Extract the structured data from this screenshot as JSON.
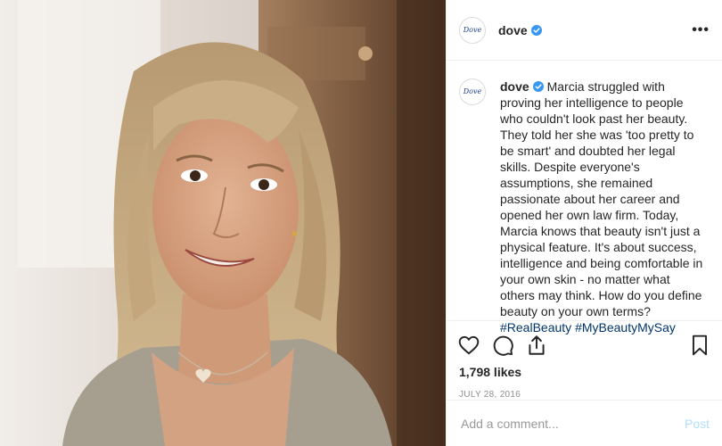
{
  "post": {
    "account": {
      "avatar_text": "Dove",
      "username": "dove",
      "verified": true
    },
    "header": {
      "more_icon": "more-horizontal-icon",
      "more_label": "•••"
    },
    "caption": {
      "username": "dove",
      "text": "Marcia struggled with proving her intelligence to people who couldn't look past her beauty. They told her she was 'too pretty to be smart' and doubted her legal skills. Despite everyone's assumptions, she remained passionate about her career and opened her own law firm. Today, Marcia knows that beauty isn't just a physical feature. It's about success, intelligence and being comfortable in your own skin - no matter what others may think. How do you define beauty on your own terms?",
      "hashtags": [
        "#RealBeauty",
        "#MyBeautyMySay"
      ]
    },
    "actions": {
      "like_icon": "heart-icon",
      "comment_icon": "comment-icon",
      "share_icon": "share-icon",
      "save_icon": "bookmark-icon"
    },
    "likes_text": "1,798 likes",
    "date": "JULY 28, 2016",
    "comment": {
      "placeholder": "Add a comment...",
      "post_label": "Post"
    },
    "colors": {
      "text": "#262626",
      "muted": "#8e8e8e",
      "hashtag": "#003569",
      "verified": "#3897f0",
      "post_disabled": "#b2dffc",
      "border": "#efefef"
    }
  }
}
